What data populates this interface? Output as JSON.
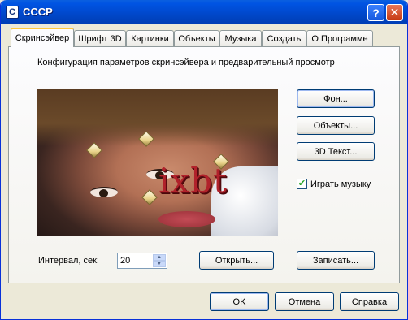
{
  "window": {
    "title": "СССР",
    "app_icon_letter": "C",
    "help_symbol": "?",
    "close_symbol": "✕"
  },
  "tabs": [
    {
      "label": "Скринсэйвер",
      "active": true
    },
    {
      "label": "Шрифт 3D"
    },
    {
      "label": "Картинки"
    },
    {
      "label": "Объекты"
    },
    {
      "label": "Музыка"
    },
    {
      "label": "Создать"
    },
    {
      "label": "О Программе"
    }
  ],
  "panel": {
    "description": "Конфигурация параметров скринсэйвера и предварительный просмотр",
    "preview_text": "ixbt",
    "buttons": {
      "background": "Фон...",
      "objects": "Объекты...",
      "text3d": "3D Текст..."
    },
    "music_checkbox": {
      "label": "Играть музыку",
      "checked": true,
      "mark": "✔"
    },
    "interval": {
      "label": "Интервал, сек:",
      "value": "20"
    },
    "open_button": "Открыть...",
    "save_button": "Записать..."
  },
  "footer": {
    "ok": "OK",
    "cancel": "Отмена",
    "help": "Справка"
  },
  "colors": {
    "title_bar": "#0054e3",
    "tab_highlight": "#ffc83c",
    "dialog_bg": "#ece9d8",
    "button_border": "#003c74"
  }
}
